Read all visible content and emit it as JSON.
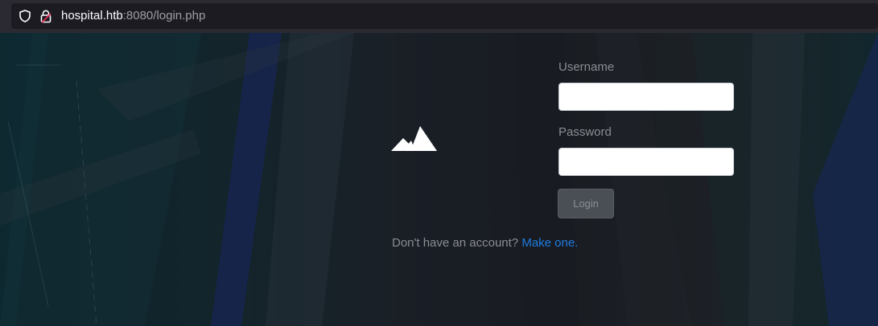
{
  "browser": {
    "url_host": "hospital.htb",
    "url_rest": ":8080/login.php",
    "icons": {
      "shield": "shield-icon",
      "lock": "insecure-lock-icon"
    }
  },
  "login": {
    "username_label": "Username",
    "username_value": "",
    "password_label": "Password",
    "password_value": "",
    "login_button": "Login",
    "signup_text": "Don't have an account?",
    "signup_link": "Make one."
  },
  "logo": {
    "icon": "mountain-icon"
  },
  "colors": {
    "link": "#1f7ae0",
    "label": "#8a8d92",
    "button_bg": "#4a4f55"
  }
}
